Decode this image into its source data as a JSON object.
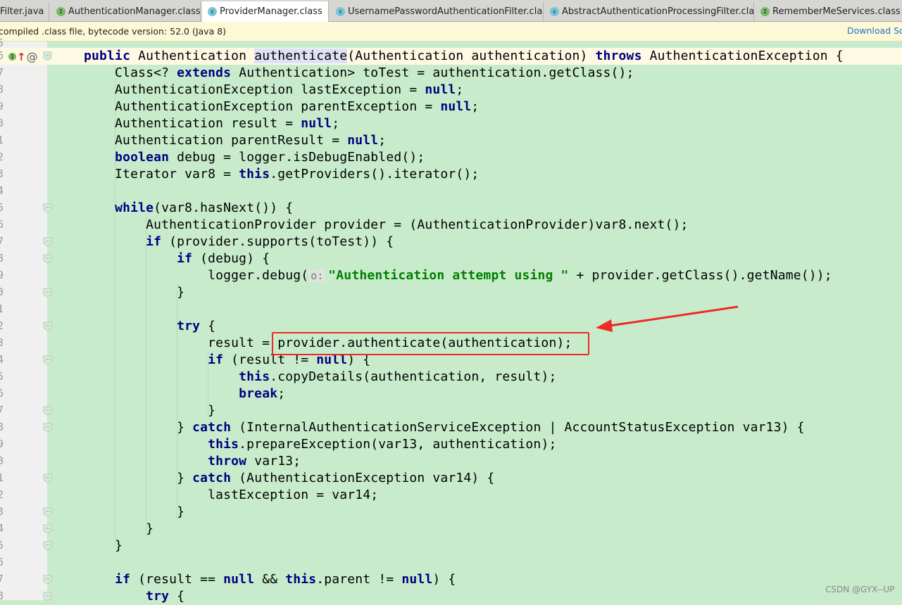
{
  "tabs": [
    {
      "label": "Filter.java",
      "icon": "none",
      "active": false
    },
    {
      "label": "AuthenticationManager.class",
      "icon": "interface",
      "active": false
    },
    {
      "label": "ProviderManager.class",
      "icon": "class",
      "active": true
    },
    {
      "label": "UsernamePasswordAuthenticationFilter.class",
      "icon": "class",
      "active": false
    },
    {
      "label": "AbstractAuthenticationProcessingFilter.class",
      "icon": "class",
      "active": false
    },
    {
      "label": "RememberMeServices.class",
      "icon": "interface",
      "active": false
    }
  ],
  "banner": {
    "message": "compiled .class file, bytecode version: 52.0 (Java 8)",
    "download": "Download So"
  },
  "gutter": {
    "top_partial": "5",
    "first_number_digit": 6
  },
  "code_lines": [
    [
      [
        "    "
      ],
      [
        "public",
        "kw"
      ],
      [
        " Authentication "
      ],
      [
        "authenticate",
        "hl"
      ],
      [
        "(Authentication authentication) "
      ],
      [
        "throws",
        "kw"
      ],
      [
        " AuthenticationException {"
      ]
    ],
    [
      [
        "        Class<? "
      ],
      [
        "extends",
        "kw"
      ],
      [
        " Authentication> toTest = authentication.getClass();"
      ]
    ],
    [
      [
        "        AuthenticationException lastException = "
      ],
      [
        "null",
        "kw"
      ],
      [
        ";"
      ]
    ],
    [
      [
        "        AuthenticationException parentException = "
      ],
      [
        "null",
        "kw"
      ],
      [
        ";"
      ]
    ],
    [
      [
        "        Authentication result = "
      ],
      [
        "null",
        "kw"
      ],
      [
        ";"
      ]
    ],
    [
      [
        "        Authentication parentResult = "
      ],
      [
        "null",
        "kw"
      ],
      [
        ";"
      ]
    ],
    [
      [
        "        "
      ],
      [
        "boolean",
        "kw"
      ],
      [
        " debug = logger.isDebugEnabled();"
      ]
    ],
    [
      [
        "        Iterator var8 = "
      ],
      [
        "this",
        "kw"
      ],
      [
        ".getProviders().iterator();"
      ]
    ],
    [],
    [
      [
        "        "
      ],
      [
        "while",
        "kw"
      ],
      [
        "(var8.hasNext()) {"
      ]
    ],
    [
      [
        "            AuthenticationProvider provider = (AuthenticationProvider)var8.next();"
      ]
    ],
    [
      [
        "            "
      ],
      [
        "if",
        "kw"
      ],
      [
        " (provider.supports(toTest)) {"
      ]
    ],
    [
      [
        "                "
      ],
      [
        "if",
        "kw"
      ],
      [
        " (debug) {"
      ]
    ],
    [
      [
        "                    logger.debug("
      ],
      [
        "o:",
        "hint"
      ],
      [
        "\"Authentication attempt using \"",
        "str"
      ],
      [
        " + provider.getClass().getName());"
      ]
    ],
    [
      [
        "                }"
      ]
    ],
    [],
    [
      [
        "                "
      ],
      [
        "try",
        "kw"
      ],
      [
        " {"
      ]
    ],
    [
      [
        "                    result = provider.authenticate(authentication);"
      ]
    ],
    [
      [
        "                    "
      ],
      [
        "if",
        "kw"
      ],
      [
        " (result != "
      ],
      [
        "null",
        "kw"
      ],
      [
        ") {"
      ]
    ],
    [
      [
        "                        "
      ],
      [
        "this",
        "kw"
      ],
      [
        ".copyDetails(authentication, result);"
      ]
    ],
    [
      [
        "                        "
      ],
      [
        "break",
        "kw"
      ],
      [
        ";"
      ]
    ],
    [
      [
        "                    }"
      ]
    ],
    [
      [
        "                } "
      ],
      [
        "catch",
        "kw"
      ],
      [
        " (InternalAuthenticationServiceException | AccountStatusException var13) {"
      ]
    ],
    [
      [
        "                    "
      ],
      [
        "this",
        "kw"
      ],
      [
        ".prepareException(var13, authentication);"
      ]
    ],
    [
      [
        "                    "
      ],
      [
        "throw",
        "kw"
      ],
      [
        " var13;"
      ]
    ],
    [
      [
        "                } "
      ],
      [
        "catch",
        "kw"
      ],
      [
        " (AuthenticationException var14) {"
      ]
    ],
    [
      [
        "                    lastException = var14;"
      ]
    ],
    [
      [
        "                }"
      ]
    ],
    [
      [
        "            }"
      ]
    ],
    [
      [
        "        }"
      ]
    ],
    [],
    [
      [
        "        "
      ],
      [
        "if",
        "kw"
      ],
      [
        " (result == "
      ],
      [
        "null",
        "kw"
      ],
      [
        " && "
      ],
      [
        "this",
        "kw"
      ],
      [
        ".parent != "
      ],
      [
        "null",
        "kw"
      ],
      [
        ") {"
      ]
    ],
    [
      [
        "            "
      ],
      [
        "try",
        "kw"
      ],
      [
        " {"
      ]
    ]
  ],
  "fold_rows": [
    0,
    9,
    11,
    12,
    14,
    16,
    18,
    21,
    22,
    25,
    27,
    28,
    29,
    31,
    32
  ],
  "annotation": {
    "highlighted_line": 17,
    "color": "#ee2a24"
  },
  "watermark": "CSDN @GYX--UP",
  "colors": {
    "keyword": "#000080",
    "string": "#008000",
    "background": "#c8ebcb",
    "current_line": "#fdf9e3"
  }
}
